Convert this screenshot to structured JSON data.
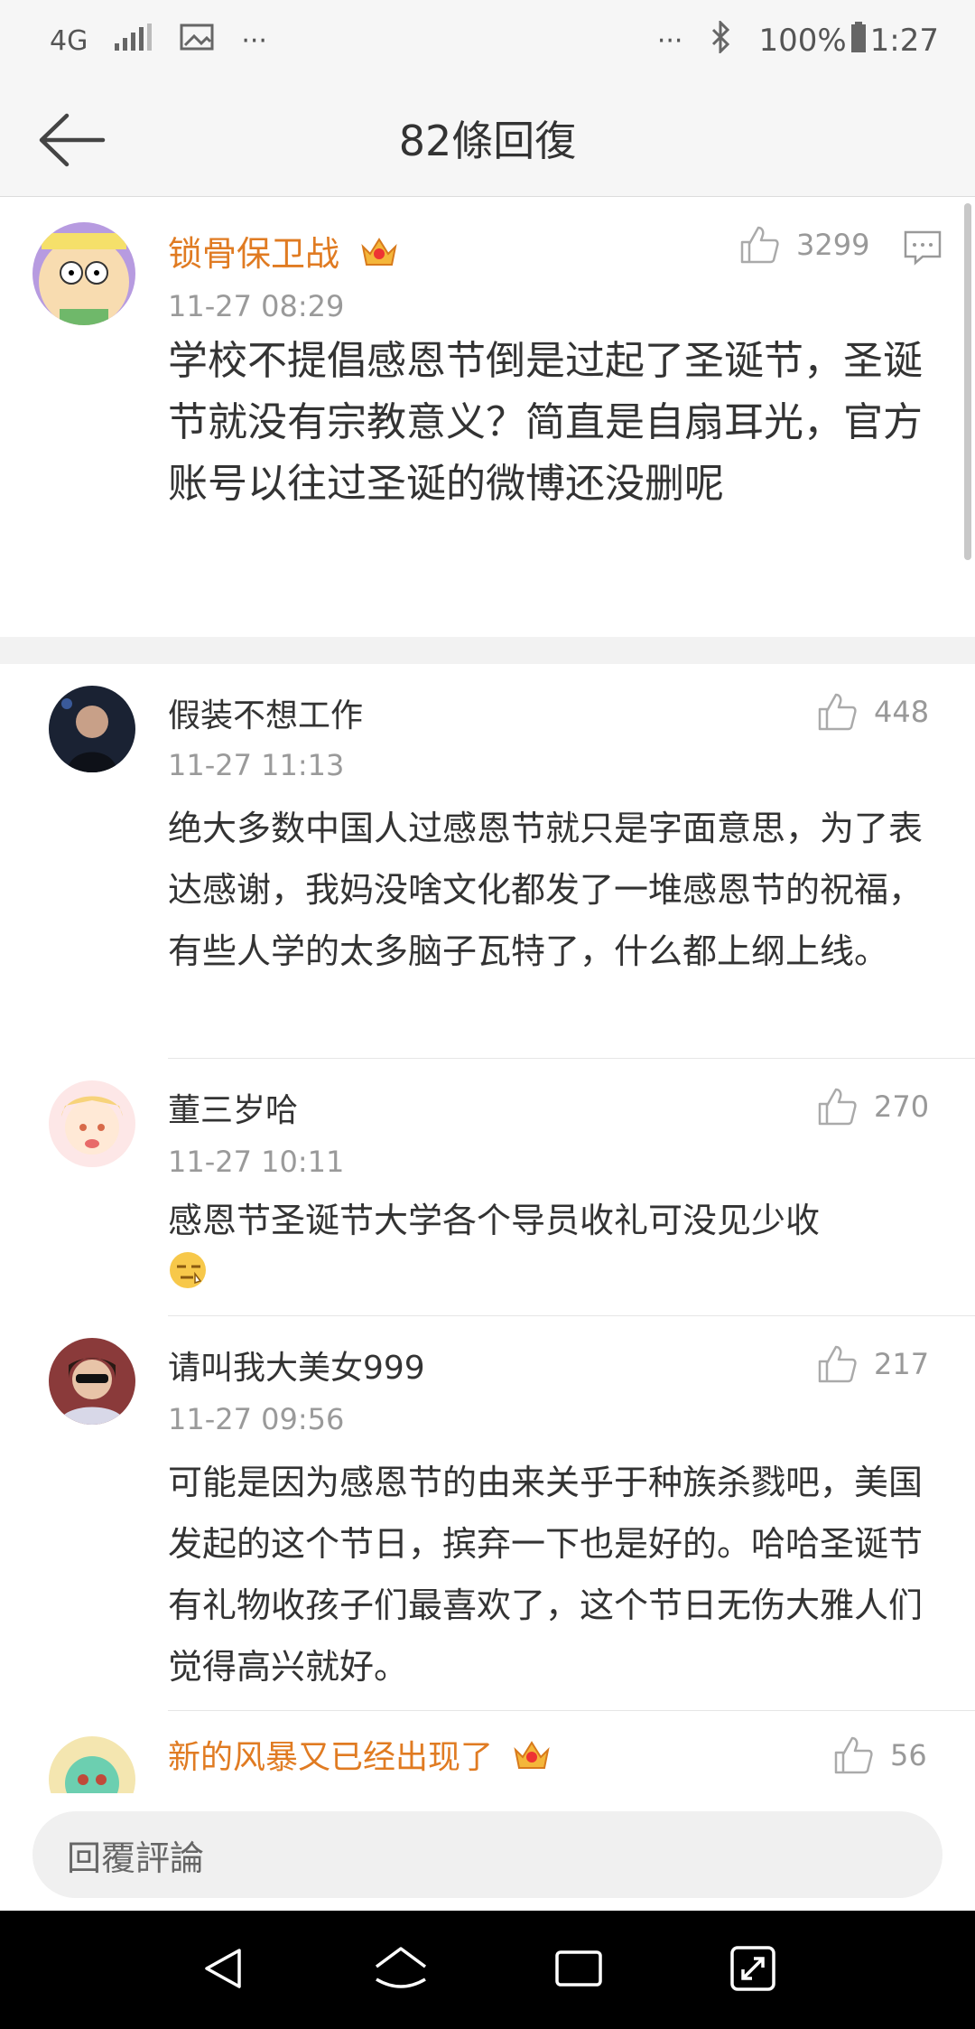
{
  "status_bar": {
    "network": "4G",
    "battery": "100%",
    "time": "1:27"
  },
  "header": {
    "title": "82條回復"
  },
  "main_comment": {
    "username": "锁骨保卫战",
    "time": "11-27 08:29",
    "likes": "3299",
    "text": "学校不提倡感恩节倒是过起了圣诞节，圣诞节就没有宗教意义？简直是自扇耳光，官方账号以往过圣诞的微博还没删呢"
  },
  "replies": [
    {
      "username": "假装不想工作",
      "time": "11-27 11:13",
      "likes": "448",
      "text": "绝大多数中国人过感恩节就只是字面意思，为了表达感谢，我妈没啥文化都发了一堆感恩节的祝福，有些人学的太多脑子瓦特了，什么都上纲上线。"
    },
    {
      "username": "董三岁哈",
      "time": "11-27 10:11",
      "likes": "270",
      "text": "感恩节圣诞节大学各个导员收礼可没见少收"
    },
    {
      "username": "请叫我大美女999",
      "time": "11-27 09:56",
      "likes": "217",
      "text": "可能是因为感恩节的由来关乎于种族杀戮吧，美国发起的这个节日，摈弃一下也是好的。哈哈圣诞节有礼物收孩子们最喜欢了，这个节日无伤大雅人们觉得高兴就好。"
    },
    {
      "username": "新的风暴又已经出现了",
      "likes": "56"
    }
  ],
  "reply_bar": {
    "placeholder": "回覆評論"
  },
  "colors": {
    "vip_name": "#e07b22",
    "background": "#f2f2f2"
  }
}
